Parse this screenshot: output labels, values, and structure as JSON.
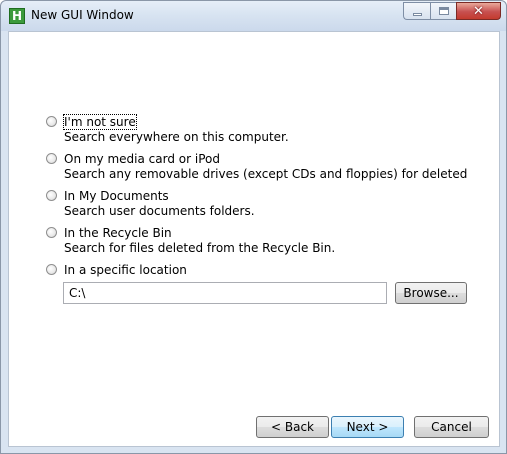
{
  "window": {
    "title": "New GUI Window",
    "app_icon_letter": "H"
  },
  "options": [
    {
      "label": "I'm not sure",
      "description": "Search everywhere on this computer."
    },
    {
      "label": "On my media card or iPod",
      "description": "Search any removable drives (except CDs and floppies) for deleted"
    },
    {
      "label": "In My Documents",
      "description": "Search user documents folders."
    },
    {
      "label": "In the Recycle Bin",
      "description": "Search for files deleted from the Recycle Bin."
    },
    {
      "label": "In a specific location",
      "description": ""
    }
  ],
  "location": {
    "value": "C:\\"
  },
  "buttons": {
    "browse": "Browse...",
    "back": "< Back",
    "next": "Next >",
    "cancel": "Cancel"
  }
}
